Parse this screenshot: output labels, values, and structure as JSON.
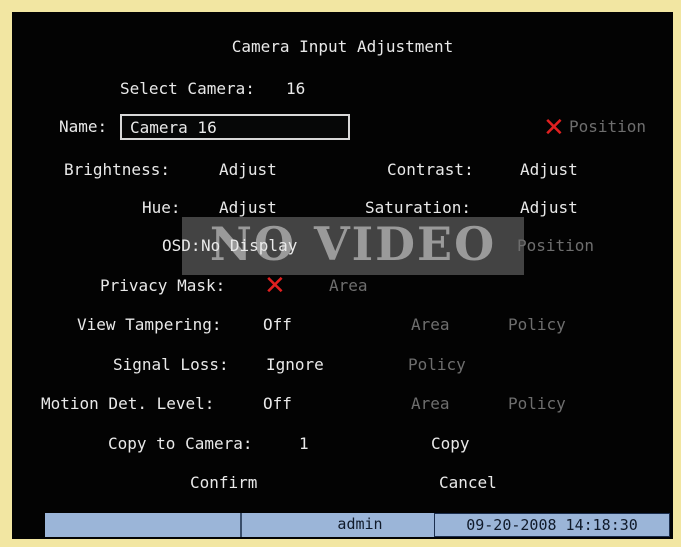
{
  "title": "Camera Input Adjustment",
  "select_camera": {
    "label": "Select Camera:",
    "value": "16"
  },
  "name": {
    "label": "Name:",
    "value": "Camera 16",
    "position_label": "Position"
  },
  "brightness": {
    "label": "Brightness:",
    "action": "Adjust"
  },
  "contrast": {
    "label": "Contrast:",
    "action": "Adjust"
  },
  "hue": {
    "label": "Hue:",
    "action": "Adjust"
  },
  "saturation": {
    "label": "Saturation:",
    "action": "Adjust"
  },
  "osd": {
    "label": "OSD:",
    "value": "No Display",
    "position_label": "Position"
  },
  "overlay": {
    "text": "NO VIDEO"
  },
  "privacy_mask": {
    "label": "Privacy Mask:",
    "area_label": "Area"
  },
  "view_tampering": {
    "label": "View Tampering:",
    "value": "Off",
    "area_label": "Area",
    "policy_label": "Policy"
  },
  "signal_loss": {
    "label": "Signal Loss:",
    "value": "Ignore",
    "policy_label": "Policy"
  },
  "motion_det": {
    "label": "Motion Det. Level:",
    "value": "Off",
    "area_label": "Area",
    "policy_label": "Policy"
  },
  "copy_to_camera": {
    "label": "Copy to Camera:",
    "value": "1",
    "copy_label": "Copy"
  },
  "buttons": {
    "confirm": "Confirm",
    "cancel": "Cancel"
  },
  "status": {
    "user": "admin",
    "datetime": "09-20-2008 14:18:30"
  },
  "colors": {
    "background": "#030303",
    "text": "#e9e9e9",
    "disabled": "#6e6e6e",
    "cross": "#e02020",
    "statusbar": "#9bb5d8"
  },
  "icons": {
    "position_unchecked": "x-icon",
    "privacy_mask_unchecked": "x-icon"
  }
}
